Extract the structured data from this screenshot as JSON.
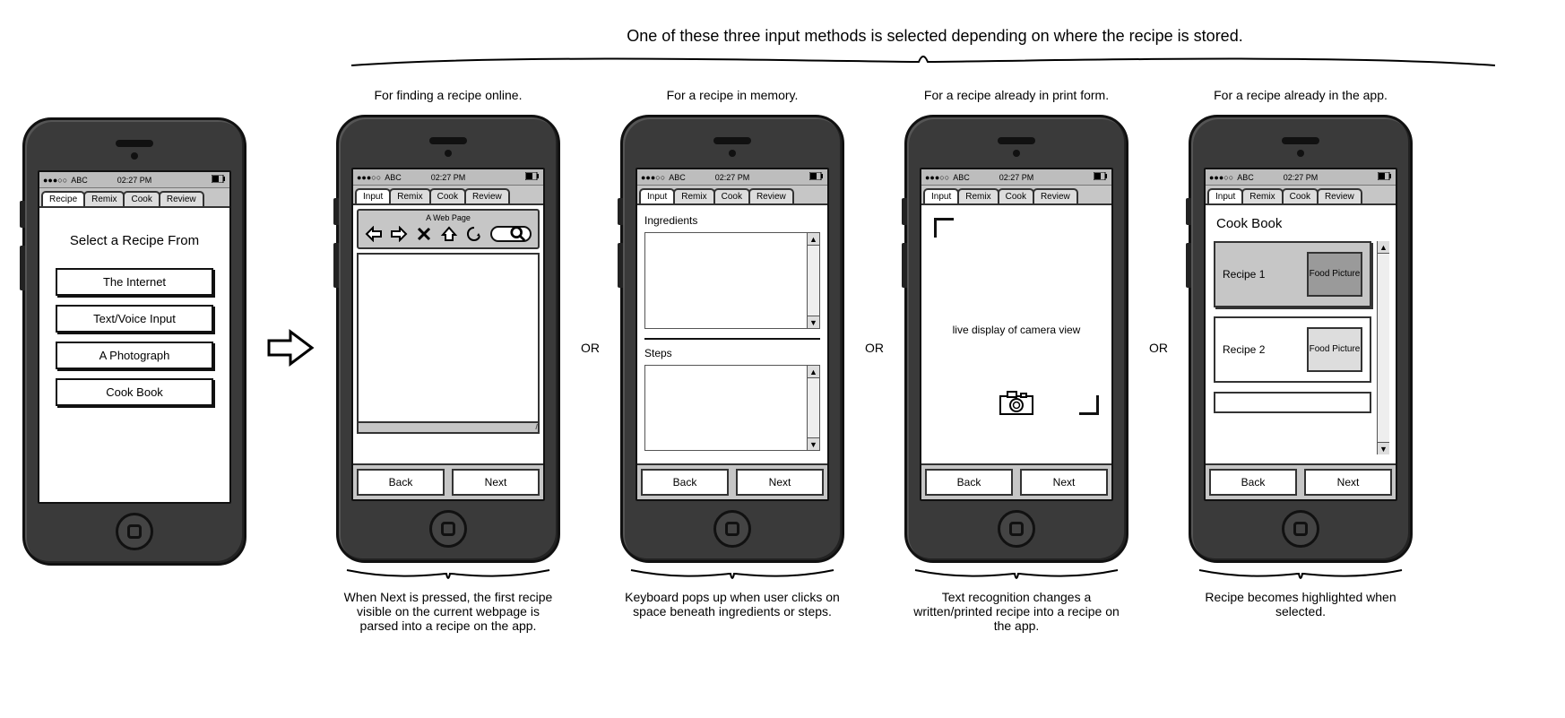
{
  "top_caption": "One of these three input methods is selected depending on where the recipe is stored.",
  "statusbar": {
    "carrier_dots": "●●●○○",
    "carrier": "ABC",
    "time": "02:27 PM"
  },
  "screens": {
    "select": {
      "tabs": [
        "Recipe",
        "Remix",
        "Cook",
        "Review"
      ],
      "active_tab": 0,
      "title": "Select a Recipe From",
      "buttons": [
        "The Internet",
        "Text/Voice Input",
        "A Photograph",
        "Cook Book"
      ]
    },
    "browser": {
      "caption_top": "For finding a recipe online.",
      "tabs": [
        "Input",
        "Remix",
        "Cook",
        "Review"
      ],
      "active_tab": 0,
      "page_label": "A Web Page",
      "back": "Back",
      "next": "Next",
      "caption_bottom": "When Next is pressed, the first recipe visible on the current webpage is parsed into a recipe on the app."
    },
    "textinput": {
      "caption_top": "For a recipe in memory.",
      "tabs": [
        "Input",
        "Remix",
        "Cook",
        "Review"
      ],
      "active_tab": 0,
      "label_ingredients": "Ingredients",
      "label_steps": "Steps",
      "back": "Back",
      "next": "Next",
      "caption_bottom": "Keyboard pops up when user clicks on space beneath ingredients or steps."
    },
    "camera": {
      "caption_top": "For a recipe already in print form.",
      "tabs": [
        "Input",
        "Remix",
        "Cook",
        "Review"
      ],
      "active_tab": 0,
      "live_text": "live display of camera view",
      "back": "Back",
      "next": "Next",
      "caption_bottom": "Text recognition changes a written/printed recipe into a recipe on the app."
    },
    "cookbook": {
      "caption_top": "For a recipe already in the app.",
      "tabs": [
        "Input",
        "Remix",
        "Cook",
        "Review"
      ],
      "active_tab": 0,
      "title": "Cook Book",
      "items": [
        {
          "name": "Recipe 1",
          "pic": "Food Picture",
          "selected": true
        },
        {
          "name": "Recipe 2",
          "pic": "Food Picture",
          "selected": false
        }
      ],
      "back": "Back",
      "next": "Next",
      "caption_bottom": "Recipe becomes highlighted when selected."
    }
  },
  "or_label": "OR"
}
